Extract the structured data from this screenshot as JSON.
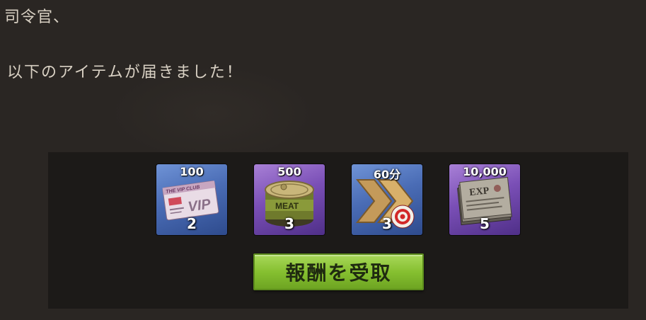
{
  "letter": {
    "greeting": "司令官、",
    "message": "以下のアイテムが届きました！"
  },
  "rewards": [
    {
      "amount": "100",
      "count": "2",
      "icon": "vip-card-icon",
      "rarity": "blue",
      "frame_color": "#4a6cb5"
    },
    {
      "amount": "500",
      "count": "3",
      "icon": "meat-can-icon",
      "rarity": "purple",
      "frame_color": "#7a4fb6"
    },
    {
      "amount": "60分",
      "count": "3",
      "icon": "speedup-icon",
      "rarity": "blue",
      "frame_color": "#4a6cb5"
    },
    {
      "amount": "10,000",
      "count": "5",
      "icon": "exp-book-icon",
      "rarity": "purple",
      "frame_color": "#7a4fb6"
    }
  ],
  "claim_button": {
    "label": "報酬を受取",
    "color": "#86c030"
  },
  "colors": {
    "background": "#2a2623",
    "panel": "#1c1a18",
    "text": "#d9d1c4"
  }
}
